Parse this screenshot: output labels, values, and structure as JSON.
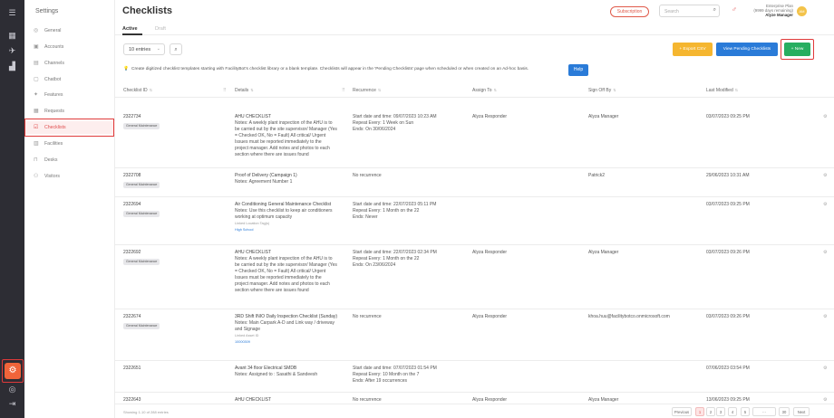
{
  "settings": {
    "title": "Settings"
  },
  "sidebar": {
    "items": [
      {
        "label": "General",
        "icon": "globe-icon",
        "glyph": "◎"
      },
      {
        "label": "Accounts",
        "icon": "accounts-icon",
        "glyph": "▣"
      },
      {
        "label": "Channels",
        "icon": "channels-icon",
        "glyph": "▤"
      },
      {
        "label": "Chatbot",
        "icon": "chatbot-icon",
        "glyph": "▢"
      },
      {
        "label": "Features",
        "icon": "features-icon",
        "glyph": "✦"
      },
      {
        "label": "Requests",
        "icon": "requests-icon",
        "glyph": "▦"
      },
      {
        "label": "Checklists",
        "icon": "checklist-icon",
        "glyph": "☑"
      },
      {
        "label": "Facilities",
        "icon": "facilities-icon",
        "glyph": "▥"
      },
      {
        "label": "Desks",
        "icon": "desk-icon",
        "glyph": "⊓"
      },
      {
        "label": "Visitors",
        "icon": "visitors-icon",
        "glyph": "⚇"
      }
    ]
  },
  "header": {
    "title": "Checklists",
    "subscription": "Subscription",
    "search_placeholder": "Search",
    "plan": "Enterprise Plan",
    "plan_note": "(9999 days remaining)",
    "user": "Alyze Manager",
    "avatar_initials": "AM"
  },
  "tabs": {
    "active": "Active",
    "draft": "Draft"
  },
  "toolbar": {
    "entries": "10 entries",
    "export_csv": "+ Export CSV",
    "view_pending": "View Pending Checklists",
    "new": "+ New"
  },
  "info": {
    "text": "Create digitized checklist templates starting with FacilityBot's checklist library or a blank template. Checklists will appear in the 'Pending Checklists' page when scheduled or when created on an Ad-hoc basis.",
    "help": "Help"
  },
  "table": {
    "headers": [
      "Checklist ID",
      "Details",
      "Recurrence",
      "Assign To",
      "Sign Off By",
      "Last Modified"
    ],
    "rows": [
      {
        "id": "2322734",
        "category": "General Maintenance",
        "details": [
          "AHU CHECKLIST",
          "Notes: A weekly plant inspection of the AHU is to",
          "be carried out by the site supervisor/ Manager (Yes",
          "= Checked OK, No = Fault) All critical/ Urgent",
          "Issues must be reported immediately to the",
          "project manager. Add notes and photos to each",
          "section where there are issues found"
        ],
        "recurrence": [
          "Start date and time: 09/07/2023 10:23 AM",
          "Repeat Every: 1 Week on Sun",
          "Ends: On 30/06/2024"
        ],
        "assign": "Alyza Responder",
        "signoff": "Alyza Manager",
        "modified": "03/07/2023 09:25 PM"
      },
      {
        "id": "2322708",
        "category": "General Maintenance",
        "details": [
          "Proof of Delivery (Campaign 1)",
          "Notes: Agreement Number 1"
        ],
        "recurrence": [
          "No recurrence"
        ],
        "assign": "",
        "signoff": "Patrick2",
        "modified": "29/06/2023 10:31 AM"
      },
      {
        "id": "2322694",
        "category": "General Maintenance",
        "details": [
          "Air Conditioning General Maintenance Checklist",
          "Notes: Use this checklist to keep air conditioners",
          "working at optimum capacity"
        ],
        "linked_label": "Linked Location Tag(s)",
        "linked_value": "High School",
        "recurrence": [
          "Start date and time: 22/07/2023 05:11 PM",
          "Repeat Every: 1 Month on the 22",
          "Ends: Never"
        ],
        "assign": "",
        "signoff": "",
        "modified": "03/07/2023 09:25 PM"
      },
      {
        "id": "2322692",
        "category": "General Maintenance",
        "details": [
          "AHU CHECKLIST",
          "Notes: A weekly plant inspection of the AHU is to",
          "be carried out by the site supervisor/ Manager (Yes",
          "= Checked OK, No = Fault) All critical/ Urgent",
          "Issues must be reported immediately to the",
          "project manager. Add notes and photos to each",
          "section where there are issues found"
        ],
        "recurrence": [
          "Start date and time: 22/07/2023 02:34 PM",
          "Repeat Every: 1 Month on the 22",
          "Ends: On 23/06/2024"
        ],
        "assign": "Alyza Responder",
        "signoff": "Alyza Manager",
        "modified": "03/07/2023 09:26 PM"
      },
      {
        "id": "2322674",
        "category": "General Maintenance",
        "details": [
          "3RD Shift INIO Daily Inspection Checklist (Sunday)",
          "Notes: Main Carpark A-D and Link way / driveway",
          "and Signage"
        ],
        "linked_label": "Linked Asset ID",
        "linked_value": "10000309",
        "recurrence": [
          "No recurrence"
        ],
        "assign": "Alyza Responder",
        "signoff": "khoa.huu@facilitybotco.onmicrosoft.com",
        "modified": "03/07/2023 09:26 PM"
      },
      {
        "id": "2322651",
        "category": "",
        "details": [
          "Avant 34 floor Electrical SMDB",
          "Notes: Assigned to : Sasathi & Sandeesh"
        ],
        "recurrence": [
          "Start date and time: 07/07/2023 01:54 PM",
          "Repeat Every: 10 Month on the 7",
          "Ends: After 19 occurrences"
        ],
        "assign": "",
        "signoff": "",
        "modified": "07/06/2023 03:54 PM"
      },
      {
        "id": "2322643",
        "category": "",
        "details": [
          "AHU CHECKLIST"
        ],
        "recurrence": [
          "No recurrence"
        ],
        "assign": "Alyza Responder",
        "signoff": "Alyza Manager",
        "modified": "13/06/2023 09:25 PM"
      }
    ]
  },
  "footer": {
    "showing": "Showing 1-10 of 288 entries"
  },
  "pagination": [
    "Previous",
    "1",
    "2",
    "3",
    "4",
    "5",
    "···",
    "30",
    "Next"
  ]
}
